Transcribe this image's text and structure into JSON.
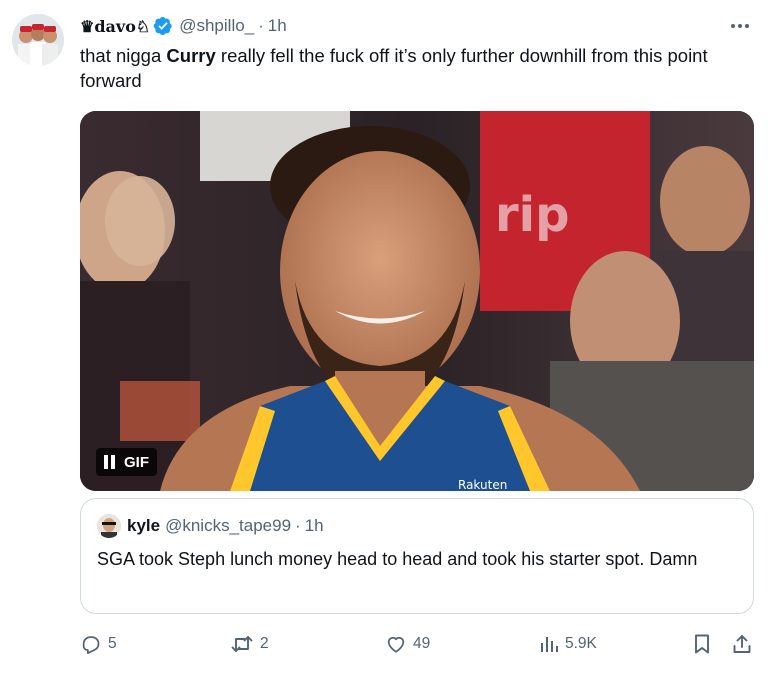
{
  "tweet": {
    "display_name": "♛davo♘",
    "handle": "@shpillo_",
    "dot": "·",
    "time": "1h",
    "text_before": "that nigga ",
    "text_bold": "Curry",
    "text_after": " really fell the fuck off it’s only further downhill from this point forward",
    "verified_icon": "verified-badge-icon",
    "more_icon": "more-horizontal-icon"
  },
  "media": {
    "badge_label": "GIF",
    "jersey_text": "Rakuten",
    "pause_icon": "pause-icon"
  },
  "quote": {
    "name": "kyle",
    "handle": "@knicks_tape99",
    "dot": "·",
    "time": "1h",
    "text": "SGA took Steph lunch money head to head and took his starter spot. Damn"
  },
  "actions": {
    "replies": "5",
    "retweets": "2",
    "likes": "49",
    "views": "5.9K",
    "icons": [
      "reply-icon",
      "retweet-icon",
      "like-icon",
      "views-icon",
      "bookmark-icon",
      "share-icon"
    ]
  },
  "colors": {
    "text": "#0f1419",
    "secondary": "#536471",
    "verified": "#1d9bf0",
    "border": "#cfd9de"
  }
}
